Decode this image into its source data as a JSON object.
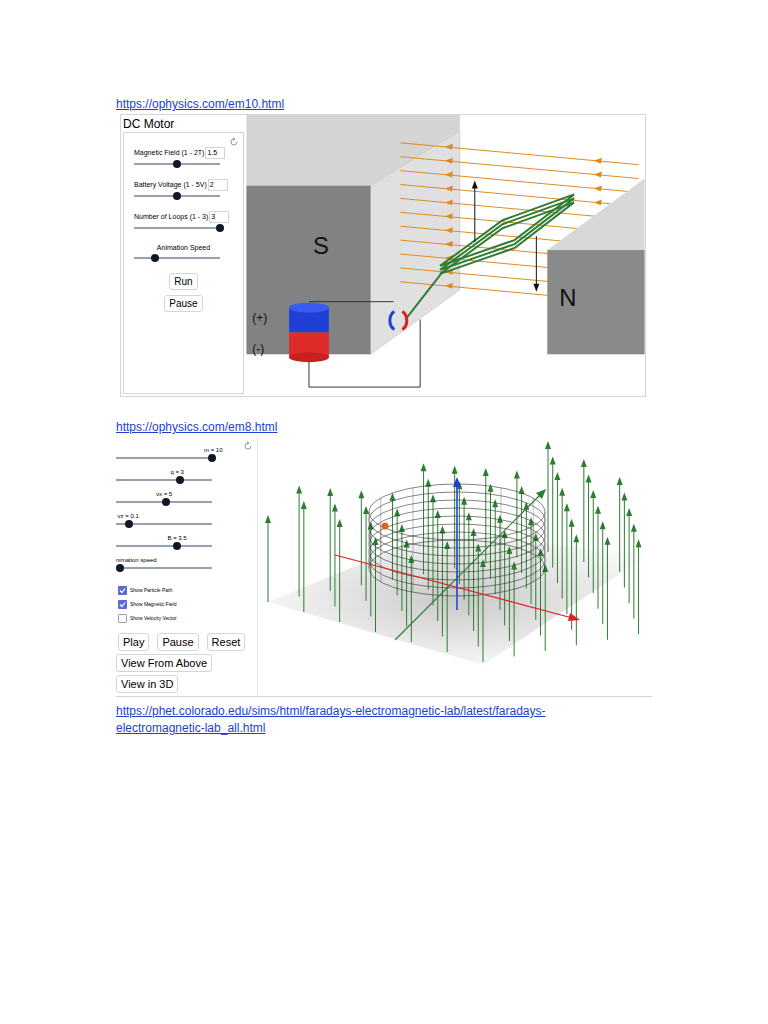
{
  "links": [
    "https://ophysics.com/em10.html",
    "https://ophysics.com/em8.html",
    "https://phet.colorado.edu/sims/html/faradays-electromagnetic-lab/latest/faradays-electromagnetic-lab_all.html"
  ],
  "dc_motor": {
    "title": "DC Motor",
    "sliders": [
      {
        "label": "Magnetic Field (1 - 2T)",
        "value": "1.5",
        "level": 0.5,
        "kind": "input"
      },
      {
        "label": "Battery Voltage (1 - 5V)",
        "value": "2",
        "level": 0.5,
        "kind": "input"
      },
      {
        "label": "Number of Loops (1 - 3)",
        "value": "3",
        "level": 1,
        "kind": "input"
      },
      {
        "label": "Animation Speed",
        "value": "",
        "level": 0.24,
        "kind": "plain"
      }
    ],
    "buttons": [
      "Run",
      "Pause"
    ],
    "scene": {
      "south_label": "S",
      "north_label": "N",
      "positive_label": "(+)",
      "negative_label": "(-)"
    }
  },
  "particle_sim": {
    "sliders": [
      {
        "label": "m = 10",
        "level": 1
      },
      {
        "label": "q = 3",
        "level": 0.65
      },
      {
        "label": "vx = 5",
        "level": 0.5
      },
      {
        "label": "vz = 0.1",
        "level": 0.1
      },
      {
        "label": "B = 3.5",
        "level": 0.62
      },
      {
        "label": "nimation speed",
        "level": 0
      }
    ],
    "checkboxes": [
      {
        "label": "Show Particle Path",
        "checked": true
      },
      {
        "label": "Show Magnetic Field",
        "checked": true
      },
      {
        "label": "Show Velocity Vector",
        "checked": false
      }
    ],
    "buttons": [
      "Play",
      "Pause",
      "Reset"
    ],
    "view_buttons": [
      "View From Above",
      "View in 3D"
    ]
  }
}
